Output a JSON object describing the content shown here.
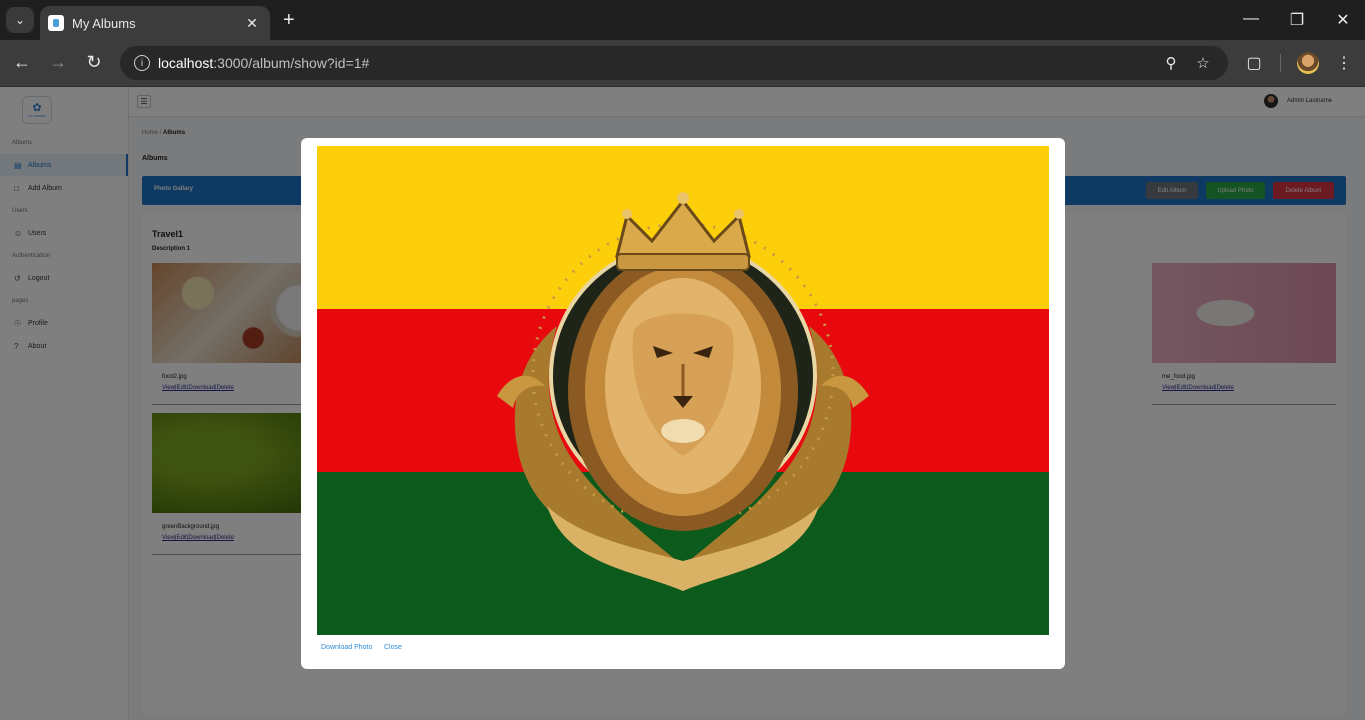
{
  "browser": {
    "tab_title": "My Albums",
    "url_host": "localhost",
    "url_rest": ":3000/album/show?id=1#"
  },
  "sidebar": {
    "logo_text": "MY ALBUMS",
    "sections": [
      {
        "label": "Albums",
        "items": [
          {
            "label": "Albums",
            "icon": "image-icon",
            "active": true
          },
          {
            "label": "Add Album",
            "icon": "file-icon",
            "active": false
          }
        ]
      },
      {
        "label": "Users",
        "items": [
          {
            "label": "Users",
            "icon": "users-icon",
            "active": false
          }
        ]
      },
      {
        "label": "Authentication",
        "items": [
          {
            "label": "Logout",
            "icon": "logout-icon",
            "active": false
          }
        ]
      },
      {
        "label": "pages",
        "items": [
          {
            "label": "Profile",
            "icon": "person-icon",
            "active": false
          },
          {
            "label": "About",
            "icon": "question-icon",
            "active": false
          }
        ]
      }
    ]
  },
  "topbar": {
    "user_name": "Admin Lastname"
  },
  "breadcrumb": {
    "home": "Home",
    "separator": "/",
    "current": "Albums"
  },
  "page": {
    "title": "Albums",
    "gallery_title": "Photo Gallary",
    "buttons": {
      "edit": "Edit Album",
      "upload": "Upload Photo",
      "delete": "Delete Album"
    },
    "album": {
      "name": "Travel1",
      "description": "Description 1",
      "photos": [
        {
          "name": "food2.jpg",
          "actions": "View|Edit|Download|Delete"
        },
        {
          "name": "me_food.jpg",
          "actions": "View|Edit|Download|Delete"
        },
        {
          "name": "greenBackground.jpg",
          "actions": "View|Edit|Download|Delete"
        }
      ]
    }
  },
  "modal": {
    "download_label": "Download Photo",
    "close_label": "Close"
  },
  "colors": {
    "primary": "#1a73c5",
    "edit_button": "#6c757d",
    "upload_button": "#28a745",
    "delete_button": "#dc3545",
    "flag_yellow": "#fdce0a",
    "flag_red": "#e8090f",
    "flag_green": "#0c5a1c"
  }
}
